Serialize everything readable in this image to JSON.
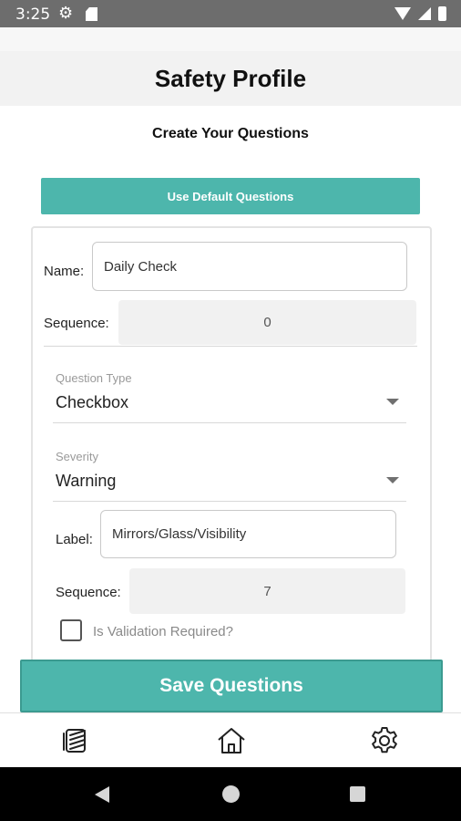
{
  "status_bar": {
    "time": "3:25",
    "icons": [
      "gear-icon",
      "sd-card-icon",
      "wifi-icon",
      "signal-icon",
      "battery-icon"
    ]
  },
  "header": {
    "title": "Safety Profile"
  },
  "subtitle": "Create Your Questions",
  "default_button_label": "Use Default Questions",
  "profile": {
    "name_label": "Name:",
    "name_value": "Daily Check",
    "sequence_label": "Sequence:",
    "sequence_value": "0"
  },
  "question": {
    "type_caption": "Question Type",
    "type_value": "Checkbox",
    "severity_caption": "Severity",
    "severity_value": "Warning",
    "label_label": "Label:",
    "label_value": "Mirrors/Glass/Visibility",
    "sequence_label": "Sequence:",
    "sequence_value": "7",
    "validation_label": "Is Validation Required?",
    "validation_checked": false
  },
  "save_button_label": "Save Questions",
  "tabs": [
    {
      "icon": "list-icon"
    },
    {
      "icon": "home-icon"
    },
    {
      "icon": "settings-icon"
    }
  ],
  "colors": {
    "accent": "#4db6ac",
    "status_bar": "#6d6d6d",
    "nav_bar": "#000000"
  }
}
